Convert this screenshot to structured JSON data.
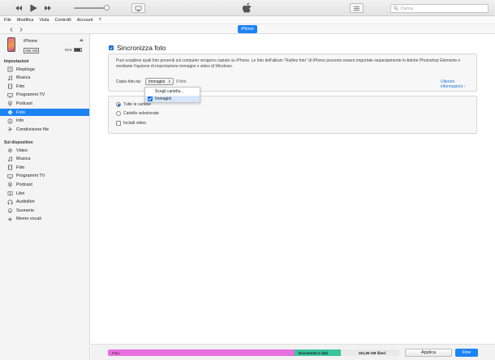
{
  "toolbar": {
    "search_placeholder": "Cerca",
    "icons": [
      "rewind-icon",
      "play-icon",
      "fast-forward-icon",
      "airplay-icon",
      "apple-logo-icon",
      "list-view-icon",
      "search-icon"
    ]
  },
  "menu": [
    "File",
    "Modifica",
    "Vista",
    "Controlli",
    "Account",
    "?"
  ],
  "nav": {
    "device_tab": "iPhone"
  },
  "device": {
    "name": "iPhone",
    "capacity": "256 GB",
    "battery": "91%",
    "battery_level": 0.91
  },
  "sidebar": {
    "settings_title": "Impostazioni",
    "settings_items": [
      {
        "label": "Riepilogo",
        "icon": "summary-icon"
      },
      {
        "label": "Musica",
        "icon": "music-note-icon"
      },
      {
        "label": "Film",
        "icon": "film-icon"
      },
      {
        "label": "Programmi TV",
        "icon": "tv-icon"
      },
      {
        "label": "Podcast",
        "icon": "podcast-icon"
      },
      {
        "label": "Foto",
        "icon": "photo-icon",
        "selected": true
      },
      {
        "label": "Info",
        "icon": "info-icon"
      },
      {
        "label": "Condivisione file",
        "icon": "file-sharing-icon"
      }
    ],
    "device_title": "Sul dispositivo",
    "device_items": [
      {
        "label": "Video",
        "icon": "gear-icon"
      },
      {
        "label": "Musica",
        "icon": "music-note-icon"
      },
      {
        "label": "Film",
        "icon": "film-icon"
      },
      {
        "label": "Programmi TV",
        "icon": "tv-icon"
      },
      {
        "label": "Podcast",
        "icon": "podcast-icon"
      },
      {
        "label": "Libri",
        "icon": "book-icon"
      },
      {
        "label": "Audiolibri",
        "icon": "audiobook-icon"
      },
      {
        "label": "Suonerie",
        "icon": "bell-icon"
      },
      {
        "label": "Memo vocali",
        "icon": "voice-memo-icon"
      }
    ]
  },
  "main": {
    "sync_title": "Sincronizza foto",
    "sync_checked": true,
    "description": "Puoi scegliere quali foto presenti sul computer vengono copiate su iPhone. Le foto dell'album \"Rullino foto\" di iPhone possono essere importate separatamente in Adobe Photoshop Elements o mediante l'opzione di importazione immagini e video di Windows.",
    "copy_from_label": "Copia foto da:",
    "copy_from_value": "Immagini",
    "photo_count": "0 foto",
    "more_info": "Ulteriori informazioni",
    "dropdown": [
      {
        "label": "Scegli cartella...",
        "checked": false
      },
      {
        "label": "Immagini",
        "checked": true
      }
    ],
    "options": {
      "all_folders": "Tutte le cartelle",
      "selected_folders": "Cartelle selezionate",
      "include_videos": "Includi video"
    }
  },
  "storage": {
    "segments": [
      {
        "label": "Foto",
        "color": "#e96ee0",
        "fraction": 0.64
      },
      {
        "label": "Documenti e dati",
        "color": "#38c49c",
        "fraction": 0.16
      },
      {
        "label": "161,55 GB liberi",
        "color": "#e9e9e9",
        "fraction": 0.2
      }
    ]
  },
  "buttons": {
    "apply": "Applica",
    "done": "Fine"
  },
  "colors": {
    "accent": "#1c83f3"
  }
}
